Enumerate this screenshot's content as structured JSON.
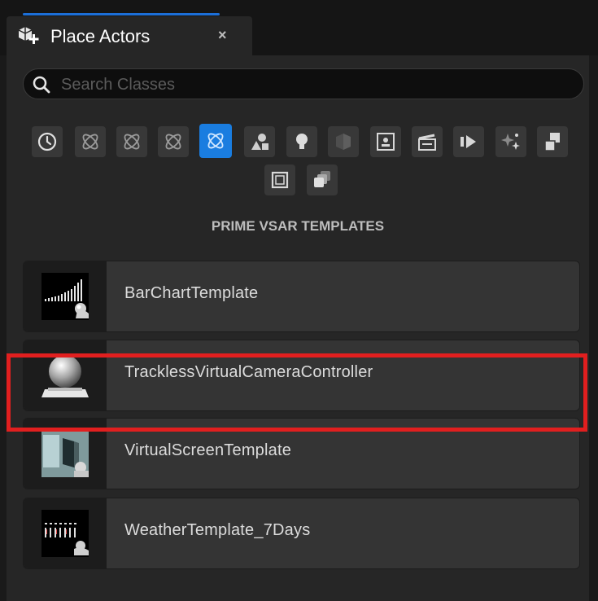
{
  "tab": {
    "title": "Place Actors",
    "close": "×"
  },
  "search": {
    "placeholder": "Search Classes",
    "value": ""
  },
  "categories": [
    {
      "name": "recent-icon"
    },
    {
      "name": "atom-icon"
    },
    {
      "name": "atom-icon"
    },
    {
      "name": "atom-icon"
    },
    {
      "name": "atom-icon",
      "active": true
    },
    {
      "name": "shapes-icon"
    },
    {
      "name": "light-icon"
    },
    {
      "name": "cube-icon"
    },
    {
      "name": "volume-icon"
    },
    {
      "name": "cinematic-icon"
    },
    {
      "name": "media-icon"
    },
    {
      "name": "effects-icon"
    },
    {
      "name": "blocks-icon"
    },
    {
      "name": "square-icon"
    },
    {
      "name": "stack-icon"
    }
  ],
  "section": {
    "title": "PRIME VSAR TEMPLATES"
  },
  "items": [
    {
      "label": "BarChartTemplate",
      "thumb": "barchart-thumbnail"
    },
    {
      "label": "TracklessVirtualCameraController",
      "thumb": "sphere-thumbnail"
    },
    {
      "label": "VirtualScreenTemplate",
      "thumb": "virtual-screen-thumbnail",
      "highlighted": true
    },
    {
      "label": "WeatherTemplate_7Days",
      "thumb": "weather-thumbnail"
    }
  ],
  "colors": {
    "accent": "#1a7de0",
    "highlight": "#e11f1f",
    "panel": "#262626",
    "item": "#343434"
  }
}
